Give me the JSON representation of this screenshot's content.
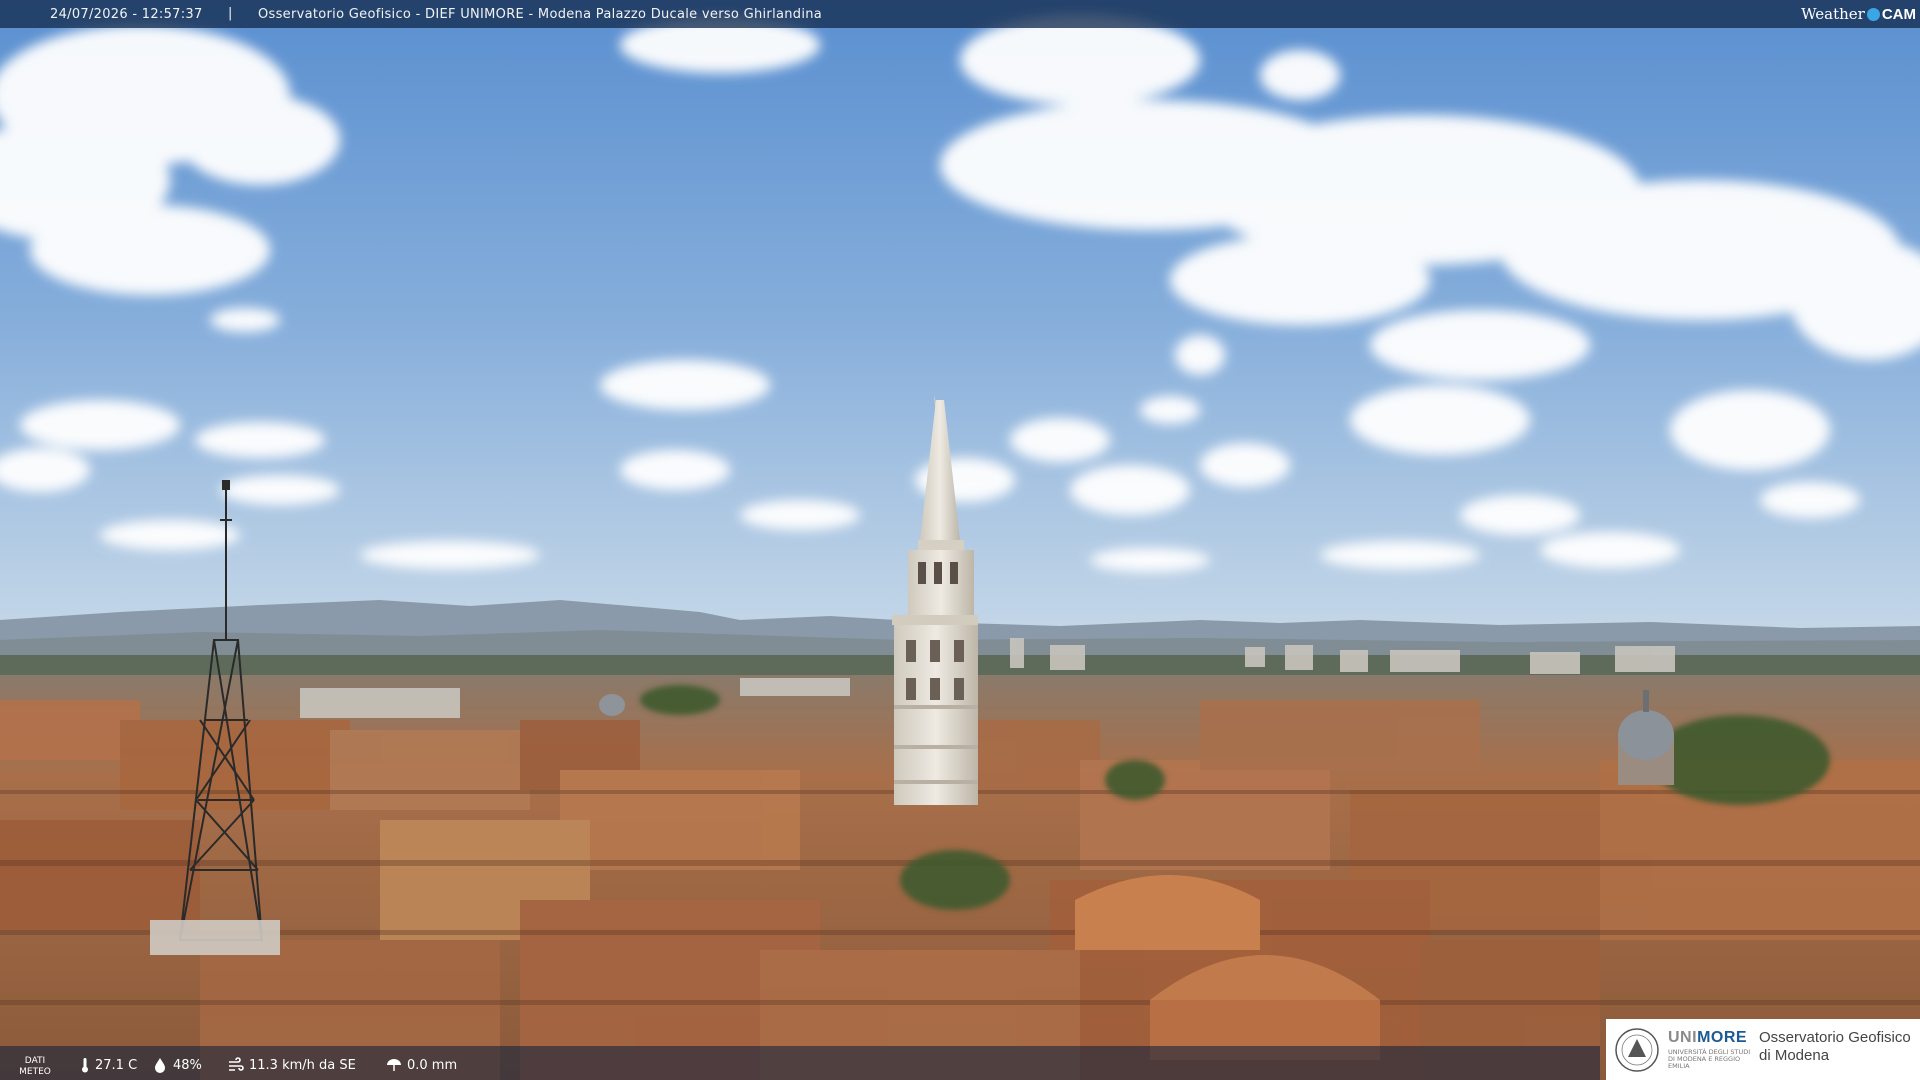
{
  "overlay": {
    "timestamp": "24/07/2026 - 12:57:37",
    "separator": "|",
    "camera_title": "Osservatorio Geofisico - DIEF UNIMORE - Modena Palazzo Ducale verso Ghirlandina",
    "brand_weather": "Weather",
    "brand_cam": "CAM"
  },
  "meteo": {
    "label_line1": "DATI",
    "label_line2": "METEO",
    "temperature": "27.1 C",
    "humidity": "48%",
    "wind": "11.3 km/h da SE",
    "rain": "0.0 mm"
  },
  "logo": {
    "uni_gray": "UNI",
    "uni_blue": "MORE",
    "uni_sub": "UNIVERSITÀ DEGLI STUDI DI MODENA E REGGIO EMILIA",
    "obs_line1": "Osservatorio Geofisico",
    "obs_line2": "di Modena"
  },
  "colors": {
    "sky_top": "#5a8fd0",
    "sky_bottom": "#c4d8ea",
    "roof": "#b8764a",
    "tower": "#e6e2d8",
    "unimore_blue": "#1d5a91"
  },
  "icons": [
    "thermometer-icon",
    "humidity-drop-icon",
    "wind-icon",
    "rain-icon",
    "unimore-seal-icon",
    "weathercam-dot-icon"
  ]
}
